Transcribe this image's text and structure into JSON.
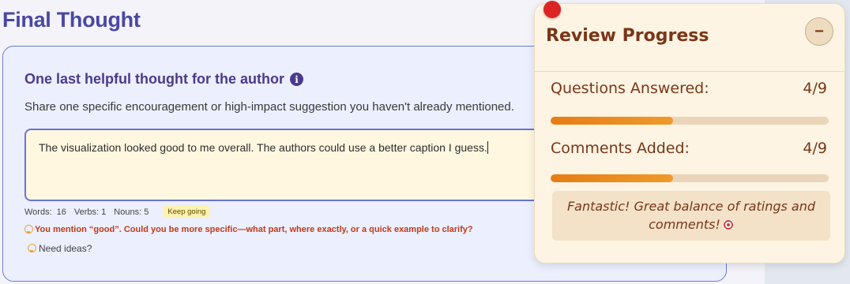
{
  "page": {
    "title": "Final Thought"
  },
  "card": {
    "heading": "One last helpful thought for the author",
    "description": "Share one specific encouragement or high-impact suggestion you haven't already mentioned.",
    "textarea_value": "The visualization looked good to me overall. The authors could use a better caption I guess.",
    "stats": {
      "words_label": "Words:",
      "words_value": "16",
      "verbs_label": "Verbs:",
      "verbs_value": "1",
      "nouns_label": "Nouns:",
      "nouns_value": "5",
      "badge": "Keep going"
    },
    "hint": "You mention “good”. Could you be more specific—what part, where exactly, or a quick example to clarify?",
    "need_ideas": "Need ideas?"
  },
  "review_progress": {
    "title": "Review Progress",
    "collapse_symbol": "−",
    "questions_label": "Questions Answered:",
    "questions_value": "4/9",
    "questions_fraction": 0.44,
    "comments_label": "Comments Added:",
    "comments_value": "4/9",
    "comments_fraction": 0.44,
    "encouragement": "Fantastic! Great balance of ratings and comments!"
  },
  "icons": {
    "info": "info-icon",
    "bulb": "lightbulb-icon",
    "target": "target-icon"
  },
  "colors": {
    "title": "#4a47a3",
    "accent_orange": "#e67d14",
    "panel_text": "#7a3618",
    "hint_red": "#c03a1a"
  }
}
